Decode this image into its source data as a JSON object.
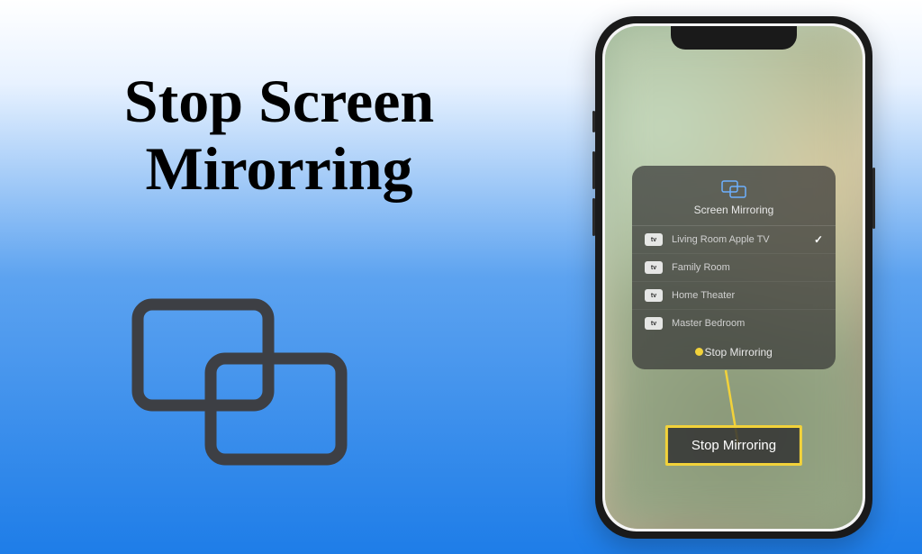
{
  "headline": {
    "line1": "Stop Screen",
    "line2": "Mirorring"
  },
  "phone": {
    "panel": {
      "title": "Screen Mirroring",
      "devices": [
        {
          "badge": "tv",
          "name": "Living Room Apple TV",
          "selected": true
        },
        {
          "badge": "tv",
          "name": "Family Room",
          "selected": false
        },
        {
          "badge": "tv",
          "name": "Home Theater",
          "selected": false
        },
        {
          "badge": "tv",
          "name": "Master Bedroom",
          "selected": false
        }
      ],
      "stop_label": "Stop Mirroring"
    },
    "callout_label": "Stop Mirroring"
  }
}
